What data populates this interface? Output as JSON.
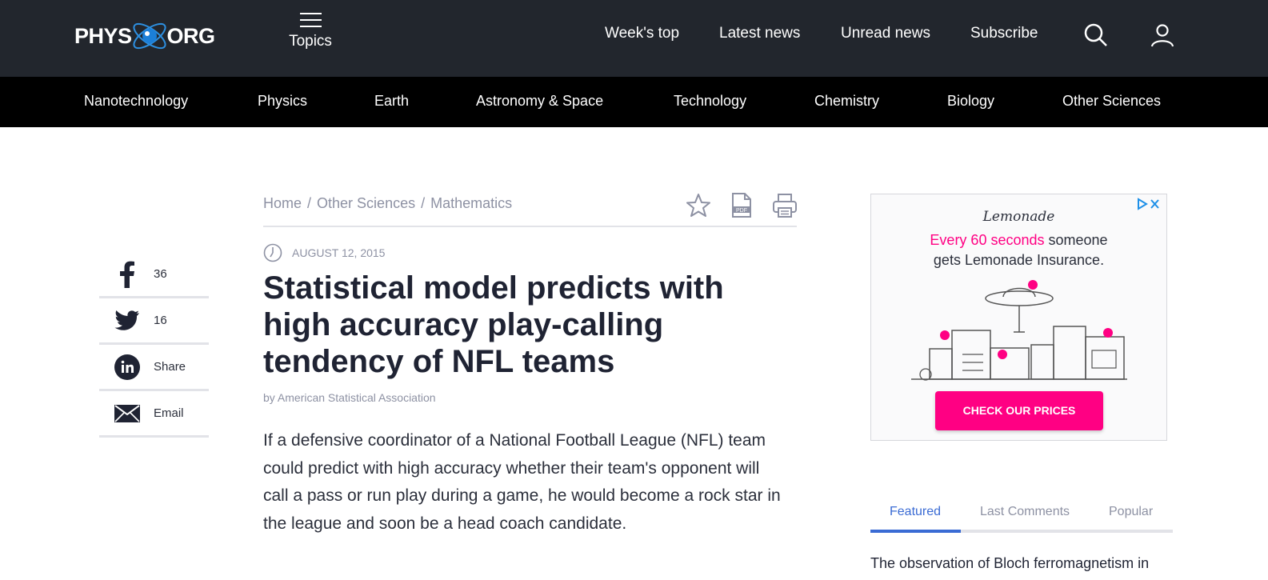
{
  "header": {
    "logo_left": "PHYS",
    "logo_right": "ORG",
    "topics_label": "Topics",
    "nav": [
      "Week's top",
      "Latest news",
      "Unread news",
      "Subscribe"
    ]
  },
  "categories": [
    "Nanotechnology",
    "Physics",
    "Earth",
    "Astronomy & Space",
    "Technology",
    "Chemistry",
    "Biology",
    "Other Sciences"
  ],
  "breadcrumb": [
    "Home",
    "Other Sciences",
    "Mathematics"
  ],
  "breadcrumb_sep": "/",
  "article": {
    "date": "AUGUST 12, 2015",
    "title": "Statistical model predicts with high accuracy play-calling tendency of NFL teams",
    "byline": "by American Statistical Association",
    "body": "If a defensive coordinator of a National Football League (NFL) team could predict with high accuracy whether their team's opponent will call a pass or run play during a game, he would become a rock star in the league and soon be a head coach candidate."
  },
  "share": {
    "facebook_count": "36",
    "twitter_count": "16",
    "linkedin_label": "Share",
    "email_label": "Email"
  },
  "ad": {
    "brand": "Lemonade",
    "line1_highlight": "Every 60 seconds",
    "line1_rest": " someone",
    "line2": "gets Lemonade Insurance.",
    "cta": "CHECK OUR PRICES",
    "pdf_label": "PDF"
  },
  "sidebar": {
    "tabs": [
      "Featured",
      "Last Comments",
      "Popular"
    ],
    "first_item": "The observation of Bloch ferromagnetism in"
  },
  "colors": {
    "header_bg": "#22262d",
    "category_bg": "#000000",
    "accent_blue": "#3a6bd4",
    "ad_pink": "#ff0083"
  }
}
